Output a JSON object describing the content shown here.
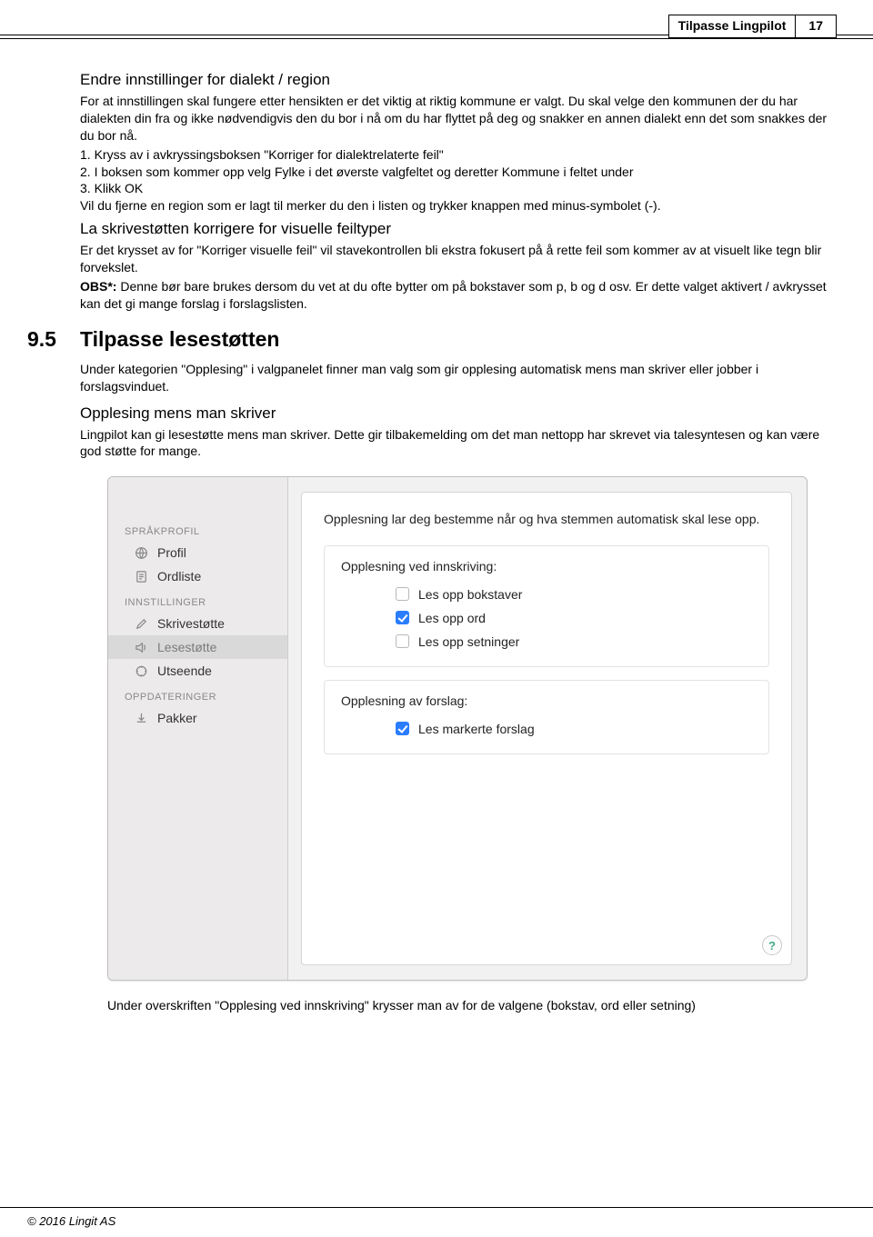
{
  "header": {
    "title": "Tilpasse Lingpilot",
    "page_number": "17"
  },
  "section_a": {
    "title": "Endre innstillinger for dialekt / region",
    "p1": "For at innstillingen skal fungere etter hensikten er det viktig at riktig kommune er valgt. Du skal velge den kommunen der du har dialekten din fra og ikke nødvendigvis den du bor i nå om du har flyttet på deg og snakker en annen dialekt enn det som snakkes der du bor nå.",
    "li1": "1. Kryss av i avkryssingsboksen \"Korriger for dialektrelaterte feil\"",
    "li2": "2. I boksen som kommer opp velg Fylke i det øverste valgfeltet og deretter Kommune i feltet under",
    "li3": "3. Klikk OK",
    "p2": "Vil du fjerne en region som er lagt til merker du den i listen og trykker knappen med minus-symbolet (-)."
  },
  "section_b": {
    "title": "La skrivestøtten korrigere for visuelle feiltyper",
    "p1": "Er det krysset av for \"Korriger visuelle feil\" vil stavekontrollen bli ekstra fokusert på å rette feil som kommer av at visuelt like tegn blir forvekslet.",
    "p2_label": "OBS*:",
    "p2": " Denne bør bare brukes dersom du vet at du ofte bytter om på bokstaver som p, b og d osv. Er dette valget aktivert / avkrysset kan det gi mange forslag i forslagslisten."
  },
  "section_c": {
    "num": "9.5",
    "title": "Tilpasse lesestøtten",
    "p1": "Under kategorien \"Opplesing\" i valgpanelet finner man valg som gir opplesing automatisk mens man skriver eller jobber i forslagsvinduet.",
    "sub_title": "Opplesing mens man skriver",
    "p2": "Lingpilot kan gi lesestøtte mens man skriver. Dette gir tilbakemelding om det man nettopp har skrevet via talesyntesen og kan være god støtte for mange."
  },
  "screenshot": {
    "sidebar": {
      "group1": "SPRÅKPROFIL",
      "item_profil": "Profil",
      "item_ordliste": "Ordliste",
      "group2": "INNSTILLINGER",
      "item_skrive": "Skrivestøtte",
      "item_lese": "Lesestøtte",
      "item_utseende": "Utseende",
      "group3": "OPPDATERINGER",
      "item_pakker": "Pakker"
    },
    "main": {
      "desc": "Opplesning lar deg bestemme når og hva stemmen automatisk skal lese opp.",
      "block1_title": "Opplesning ved innskriving:",
      "chk1": "Les opp bokstaver",
      "chk2": "Les opp ord",
      "chk3": "Les opp setninger",
      "block2_title": "Opplesning av forslag:",
      "chk4": "Les markerte forslag",
      "help": "?"
    }
  },
  "after_shot": "Under overskriften \"Opplesing ved innskriving\" krysser man av for de valgene (bokstav, ord eller setning)",
  "footer": "© 2016 Lingit AS"
}
